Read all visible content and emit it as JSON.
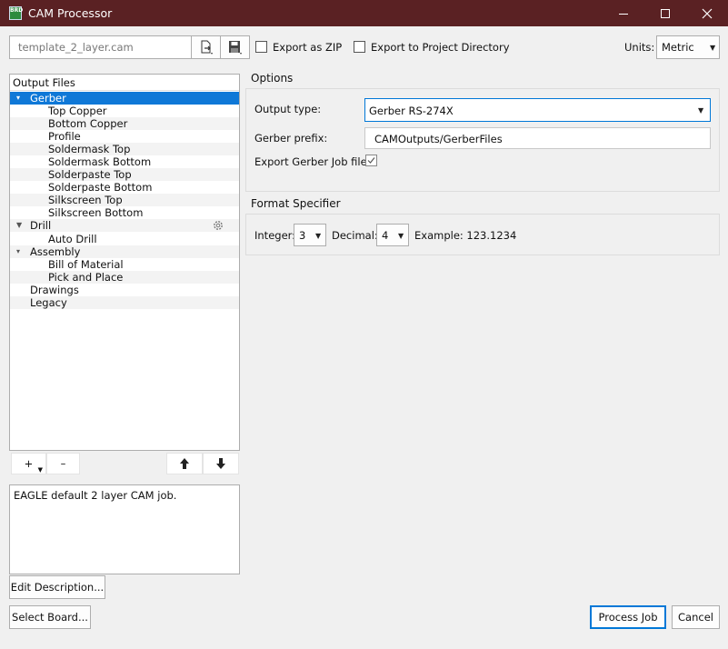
{
  "window": {
    "title": "CAM Processor",
    "app_icon_text": "BRD"
  },
  "toolbar": {
    "job_file": "template_2_layer.cam",
    "export_zip_label": "Export as ZIP",
    "export_project_label": "Export to Project Directory",
    "units_label": "Units:",
    "units_value": "Metric"
  },
  "output_files": {
    "header": "Output Files",
    "items": [
      {
        "label": "Gerber",
        "level": 0,
        "expanded": true,
        "selected": true
      },
      {
        "label": "Top Copper",
        "level": 1
      },
      {
        "label": "Bottom Copper",
        "level": 1
      },
      {
        "label": "Profile",
        "level": 1
      },
      {
        "label": "Soldermask Top",
        "level": 1
      },
      {
        "label": "Soldermask Bottom",
        "level": 1
      },
      {
        "label": "Solderpaste Top",
        "level": 1
      },
      {
        "label": "Solderpaste Bottom",
        "level": 1
      },
      {
        "label": "Silkscreen Top",
        "level": 1
      },
      {
        "label": "Silkscreen Bottom",
        "level": 1
      },
      {
        "label": "Drill",
        "level": 0,
        "expanded": true
      },
      {
        "label": "Auto Drill",
        "level": 1
      },
      {
        "label": "Assembly",
        "level": 0,
        "expanded": true
      },
      {
        "label": "Bill of Material",
        "level": 1
      },
      {
        "label": "Pick and Place",
        "level": 1
      },
      {
        "label": "Drawings",
        "level": 0
      },
      {
        "label": "Legacy",
        "level": 0
      }
    ],
    "add_label": "+",
    "remove_label": "–"
  },
  "description": {
    "text": "EAGLE default 2 layer CAM job.",
    "edit_button": "Edit Description..."
  },
  "options": {
    "header": "Options",
    "output_type_label": "Output type:",
    "output_type_value": "Gerber RS-274X",
    "gerber_prefix_label": "Gerber prefix:",
    "gerber_prefix_value": "CAMOutputs/GerberFiles",
    "export_job_label": "Export Gerber Job file:",
    "export_job_checked": true
  },
  "format": {
    "header": "Format Specifier",
    "integer_label": "Integer:",
    "integer_value": "3",
    "decimal_label": "Decimal:",
    "decimal_value": "4",
    "example_label": "Example: 123.1234"
  },
  "footer": {
    "select_board": "Select Board...",
    "process_job": "Process Job",
    "cancel": "Cancel"
  },
  "colors": {
    "titlebar": "#5a2123",
    "selection": "#0f78d7",
    "accent_border": "#0078d7"
  }
}
